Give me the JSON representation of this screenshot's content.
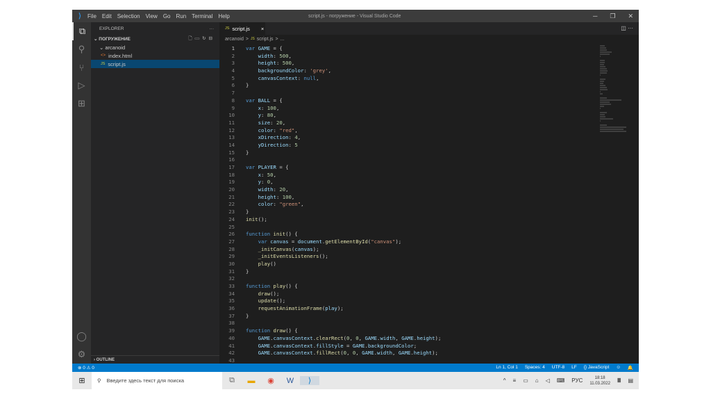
{
  "titlebar": {
    "menu": [
      "File",
      "Edit",
      "Selection",
      "View",
      "Go",
      "Run",
      "Terminal",
      "Help"
    ],
    "title": "script.js - погружение - Visual Studio Code"
  },
  "sidebar": {
    "header": "EXPLORER",
    "more": "···",
    "folder": "ПОГРУЖЕНИЕ",
    "subfolder": "arcanoid",
    "files": [
      {
        "name": "index.html",
        "icon": "<>",
        "color": "#e37933"
      },
      {
        "name": "script.js",
        "icon": "JS",
        "color": "#cbcb41"
      }
    ],
    "outline": "OUTLINE"
  },
  "editor": {
    "tab": "script.js",
    "tab_close": "×",
    "breadcrumb": [
      "arcanoid",
      ">",
      "JS",
      "script.js",
      ">",
      "..."
    ],
    "lines": [
      [
        [
          "kw",
          "var "
        ],
        [
          "id",
          "GAME"
        ],
        [
          "p",
          " = {"
        ]
      ],
      [
        [
          "id",
          "    width"
        ],
        [
          "p",
          ": "
        ],
        [
          "num",
          "500"
        ],
        [
          "p",
          ","
        ]
      ],
      [
        [
          "id",
          "    height"
        ],
        [
          "p",
          ": "
        ],
        [
          "num",
          "500"
        ],
        [
          "p",
          ","
        ]
      ],
      [
        [
          "id",
          "    backgroundColor"
        ],
        [
          "p",
          ": "
        ],
        [
          "str",
          "'grey'"
        ],
        [
          "p",
          ","
        ]
      ],
      [
        [
          "id",
          "    canvasContext"
        ],
        [
          "p",
          ": "
        ],
        [
          "kw",
          "null"
        ],
        [
          "p",
          ","
        ]
      ],
      [
        [
          "p",
          "}"
        ]
      ],
      [],
      [
        [
          "kw",
          "var "
        ],
        [
          "id",
          "BALL"
        ],
        [
          "p",
          " = {"
        ]
      ],
      [
        [
          "id",
          "    x"
        ],
        [
          "p",
          ": "
        ],
        [
          "num",
          "100"
        ],
        [
          "p",
          ","
        ]
      ],
      [
        [
          "id",
          "    y"
        ],
        [
          "p",
          ": "
        ],
        [
          "num",
          "80"
        ],
        [
          "p",
          ","
        ]
      ],
      [
        [
          "id",
          "    size"
        ],
        [
          "p",
          ": "
        ],
        [
          "num",
          "20"
        ],
        [
          "p",
          ","
        ]
      ],
      [
        [
          "id",
          "    color"
        ],
        [
          "p",
          ": "
        ],
        [
          "str",
          "\"red\""
        ],
        [
          "p",
          ","
        ]
      ],
      [
        [
          "id",
          "    xDirection"
        ],
        [
          "p",
          ": "
        ],
        [
          "num",
          "4"
        ],
        [
          "p",
          ","
        ]
      ],
      [
        [
          "id",
          "    yDirection"
        ],
        [
          "p",
          ": "
        ],
        [
          "num",
          "5"
        ]
      ],
      [
        [
          "p",
          "}"
        ]
      ],
      [],
      [
        [
          "kw",
          "var "
        ],
        [
          "id",
          "PLAYER"
        ],
        [
          "p",
          " = {"
        ]
      ],
      [
        [
          "id",
          "    x"
        ],
        [
          "p",
          ": "
        ],
        [
          "num",
          "50"
        ],
        [
          "p",
          ","
        ]
      ],
      [
        [
          "id",
          "    y"
        ],
        [
          "p",
          ": "
        ],
        [
          "num",
          "0"
        ],
        [
          "p",
          ","
        ]
      ],
      [
        [
          "id",
          "    width"
        ],
        [
          "p",
          ": "
        ],
        [
          "num",
          "20"
        ],
        [
          "p",
          ","
        ]
      ],
      [
        [
          "id",
          "    height"
        ],
        [
          "p",
          ": "
        ],
        [
          "num",
          "100"
        ],
        [
          "p",
          ","
        ]
      ],
      [
        [
          "id",
          "    color"
        ],
        [
          "p",
          ": "
        ],
        [
          "str",
          "\"green\""
        ],
        [
          "p",
          ","
        ]
      ],
      [
        [
          "p",
          "}"
        ]
      ],
      [
        [
          "fn",
          "init"
        ],
        [
          "p",
          "();"
        ]
      ],
      [],
      [
        [
          "kw",
          "function "
        ],
        [
          "fn",
          "init"
        ],
        [
          "p",
          "() {"
        ]
      ],
      [
        [
          "kw",
          "    var "
        ],
        [
          "id",
          "canvas"
        ],
        [
          "p",
          " = "
        ],
        [
          "id",
          "document"
        ],
        [
          "p",
          "."
        ],
        [
          "fn",
          "getElementById"
        ],
        [
          "p",
          "("
        ],
        [
          "str",
          "\"canvas\""
        ],
        [
          "p",
          ");"
        ]
      ],
      [
        [
          "fn",
          "    _initCanvas"
        ],
        [
          "p",
          "("
        ],
        [
          "id",
          "canvas"
        ],
        [
          "p",
          ");"
        ]
      ],
      [
        [
          "fn",
          "    _initEventsListeners"
        ],
        [
          "p",
          "();"
        ]
      ],
      [
        [
          "fn",
          "    play"
        ],
        [
          "p",
          "()"
        ]
      ],
      [
        [
          "p",
          "}"
        ]
      ],
      [],
      [
        [
          "kw",
          "function "
        ],
        [
          "fn",
          "play"
        ],
        [
          "p",
          "() {"
        ]
      ],
      [
        [
          "fn",
          "    draw"
        ],
        [
          "p",
          "();"
        ]
      ],
      [
        [
          "fn",
          "    update"
        ],
        [
          "p",
          "();"
        ]
      ],
      [
        [
          "fn",
          "    requestAnimationFrame"
        ],
        [
          "p",
          "("
        ],
        [
          "id",
          "play"
        ],
        [
          "p",
          ");"
        ]
      ],
      [
        [
          "p",
          "}"
        ]
      ],
      [],
      [
        [
          "kw",
          "function "
        ],
        [
          "fn",
          "draw"
        ],
        [
          "p",
          "() {"
        ]
      ],
      [
        [
          "id",
          "    GAME"
        ],
        [
          "p",
          "."
        ],
        [
          "id",
          "canvasContext"
        ],
        [
          "p",
          "."
        ],
        [
          "fn",
          "clearRect"
        ],
        [
          "p",
          "("
        ],
        [
          "num",
          "0"
        ],
        [
          "p",
          ", "
        ],
        [
          "num",
          "0"
        ],
        [
          "p",
          ", "
        ],
        [
          "id",
          "GAME"
        ],
        [
          "p",
          "."
        ],
        [
          "id",
          "width"
        ],
        [
          "p",
          ", "
        ],
        [
          "id",
          "GAME"
        ],
        [
          "p",
          "."
        ],
        [
          "id",
          "height"
        ],
        [
          "p",
          ");"
        ]
      ],
      [
        [
          "id",
          "    GAME"
        ],
        [
          "p",
          "."
        ],
        [
          "id",
          "canvasContext"
        ],
        [
          "p",
          "."
        ],
        [
          "id",
          "fillStyle"
        ],
        [
          "p",
          " = "
        ],
        [
          "id",
          "GAME"
        ],
        [
          "p",
          "."
        ],
        [
          "id",
          "backgroundColor"
        ],
        [
          "p",
          ";"
        ]
      ],
      [
        [
          "id",
          "    GAME"
        ],
        [
          "p",
          "."
        ],
        [
          "id",
          "canvasContext"
        ],
        [
          "p",
          "."
        ],
        [
          "fn",
          "fillRect"
        ],
        [
          "p",
          "("
        ],
        [
          "num",
          "0"
        ],
        [
          "p",
          ", "
        ],
        [
          "num",
          "0"
        ],
        [
          "p",
          ", "
        ],
        [
          "id",
          "GAME"
        ],
        [
          "p",
          "."
        ],
        [
          "id",
          "width"
        ],
        [
          "p",
          ", "
        ],
        [
          "id",
          "GAME"
        ],
        [
          "p",
          "."
        ],
        [
          "id",
          "height"
        ],
        [
          "p",
          ");"
        ]
      ],
      []
    ]
  },
  "status": {
    "problems": "⊗ 0 ⚠ 0",
    "items": [
      "Ln 1, Col 1",
      "Spaces: 4",
      "UTF-8",
      "LF",
      "{} JavaScript"
    ]
  },
  "taskbar": {
    "search_placeholder": "Введите здесь текст для поиска",
    "lang": "РУС",
    "time": "18:18",
    "date": "11.03.2022"
  },
  "colors": {
    "accent": "#007acc",
    "selection": "#094771"
  }
}
